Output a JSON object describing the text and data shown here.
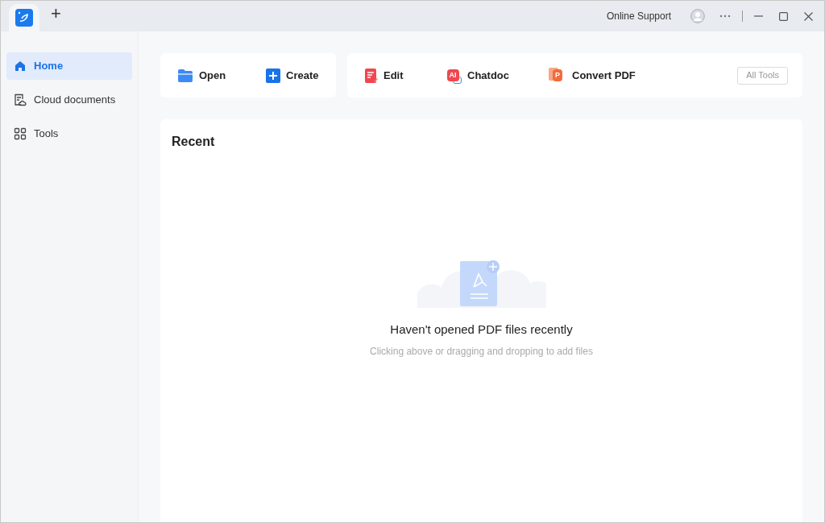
{
  "titlebar": {
    "tabs": [
      {
        "kind": "app",
        "selected": true
      }
    ],
    "new_tab": "+",
    "online_support": "Online Support"
  },
  "sidebar": {
    "items": [
      {
        "label": "Home",
        "kind": "home",
        "selected": true
      },
      {
        "label": "Cloud documents",
        "kind": "cloud",
        "selected": false
      },
      {
        "label": "Tools",
        "kind": "tools",
        "selected": false
      }
    ]
  },
  "quick_actions": [
    {
      "label": "Open",
      "kind": "open"
    },
    {
      "label": "Create",
      "kind": "create"
    }
  ],
  "tools": [
    {
      "label": "Edit",
      "kind": "edit"
    },
    {
      "label": "Chatdoc",
      "kind": "chat",
      "icon_text": "AI"
    },
    {
      "label": "Convert PDF",
      "kind": "convert",
      "icon_text": "P"
    }
  ],
  "all_tools": "All Tools",
  "recent": {
    "title": "Recent",
    "empty_title": "Haven't opened PDF files recently",
    "empty_hint": "Clicking above or dragging and dropping to add files"
  }
}
